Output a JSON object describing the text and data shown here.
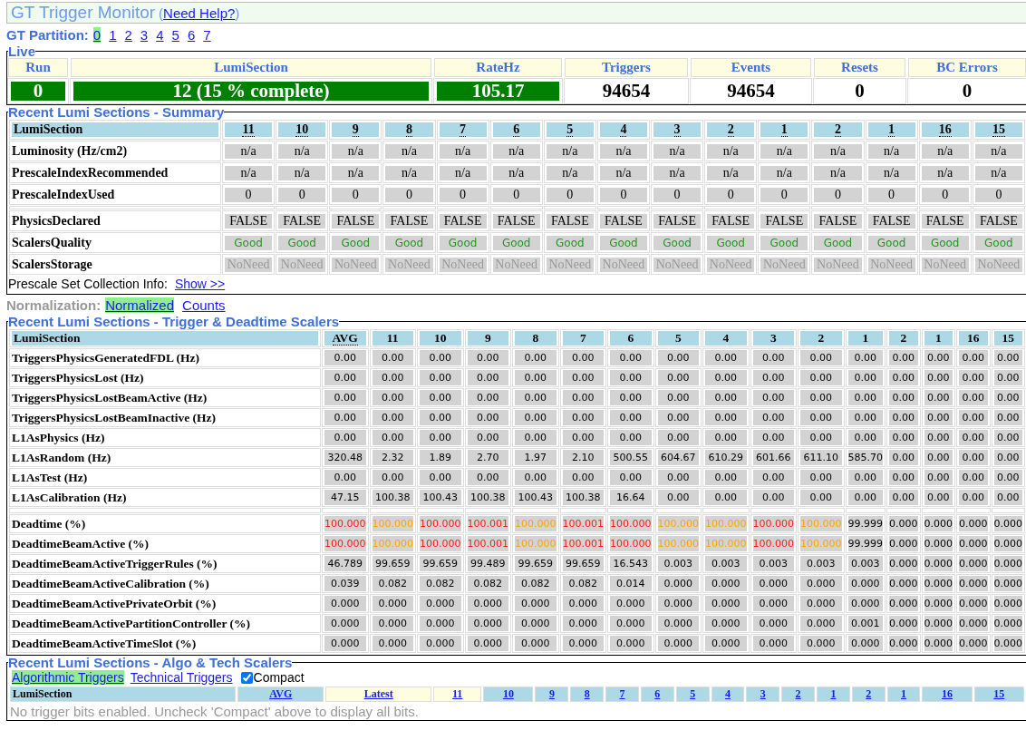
{
  "title": {
    "text": "GT Trigger Monitor",
    "paren_open": "(",
    "help_link": "Need Help?",
    "paren_close": ")"
  },
  "partition": {
    "label": "GT Partition:",
    "options": [
      {
        "label": "0",
        "selected": true
      },
      {
        "label": "1",
        "selected": false
      },
      {
        "label": "2",
        "selected": false
      },
      {
        "label": "3",
        "selected": false
      },
      {
        "label": "4",
        "selected": false
      },
      {
        "label": "5",
        "selected": false
      },
      {
        "label": "6",
        "selected": false
      },
      {
        "label": "7",
        "selected": false
      }
    ]
  },
  "live": {
    "legend": "Live",
    "items": [
      {
        "label": "Run",
        "value": "0",
        "highlighted": true
      },
      {
        "label": "LumiSection",
        "value": "12 (15 % complete)",
        "highlighted": true
      },
      {
        "label": "RateHz",
        "value": "105.17",
        "highlighted": true
      },
      {
        "label": "Triggers",
        "value": "94654",
        "highlighted": false
      },
      {
        "label": "Events",
        "value": "94654",
        "highlighted": false
      },
      {
        "label": "Resets",
        "value": "0",
        "highlighted": false
      },
      {
        "label": "BC Errors",
        "value": "0",
        "highlighted": false
      }
    ]
  },
  "summary": {
    "legend": "Recent Lumi Sections - Summary",
    "header": "LumiSection",
    "columns": [
      {
        "label": "11",
        "has_hint": true
      },
      {
        "label": "10",
        "has_hint": true
      },
      {
        "label": "9",
        "has_hint": true
      },
      {
        "label": "8",
        "has_hint": true
      },
      {
        "label": "7",
        "has_hint": true
      },
      {
        "label": "6",
        "has_hint": true
      },
      {
        "label": "5",
        "has_hint": true
      },
      {
        "label": "4",
        "has_hint": true
      },
      {
        "label": "3",
        "has_hint": true
      },
      {
        "label": "2",
        "has_hint": true
      },
      {
        "label": "1",
        "has_hint": true
      },
      {
        "label": "2",
        "has_hint": true
      },
      {
        "label": "1",
        "has_hint": true
      },
      {
        "label": "16",
        "has_hint": true
      },
      {
        "label": "15",
        "has_hint": true
      }
    ],
    "row_groups": [
      {
        "rows": [
          {
            "label": "Luminosity (Hz/cm2)",
            "kind": "plain",
            "values": [
              "n/a",
              "n/a",
              "n/a",
              "n/a",
              "n/a",
              "n/a",
              "n/a",
              "n/a",
              "n/a",
              "n/a",
              "n/a",
              "n/a",
              "n/a",
              "n/a",
              "n/a"
            ]
          },
          {
            "label": "PrescaleIndexRecommended",
            "kind": "plain",
            "values": [
              "n/a",
              "n/a",
              "n/a",
              "n/a",
              "n/a",
              "n/a",
              "n/a",
              "n/a",
              "n/a",
              "n/a",
              "n/a",
              "n/a",
              "n/a",
              "n/a",
              "n/a"
            ]
          },
          {
            "label": "PrescaleIndexUsed",
            "kind": "plain",
            "values": [
              "0",
              "0",
              "0",
              "0",
              "0",
              "0",
              "0",
              "0",
              "0",
              "0",
              "0",
              "0",
              "0",
              "0",
              "0"
            ]
          }
        ]
      },
      {
        "rows": [
          {
            "label": "PhysicsDeclared",
            "kind": "plain",
            "values": [
              "FALSE",
              "FALSE",
              "FALSE",
              "FALSE",
              "FALSE",
              "FALSE",
              "FALSE",
              "FALSE",
              "FALSE",
              "FALSE",
              "FALSE",
              "FALSE",
              "FALSE",
              "FALSE",
              "FALSE"
            ]
          },
          {
            "label": "ScalersQuality",
            "kind": "good",
            "values": [
              "Good",
              "Good",
              "Good",
              "Good",
              "Good",
              "Good",
              "Good",
              "Good",
              "Good",
              "Good",
              "Good",
              "Good",
              "Good",
              "Good",
              "Good"
            ]
          },
          {
            "label": "ScalersStorage",
            "kind": "muted",
            "values": [
              "NoNeed",
              "NoNeed",
              "NoNeed",
              "NoNeed",
              "NoNeed",
              "NoNeed",
              "NoNeed",
              "NoNeed",
              "NoNeed",
              "NoNeed",
              "NoNeed",
              "NoNeed",
              "NoNeed",
              "NoNeed",
              "NoNeed"
            ]
          }
        ]
      }
    ],
    "prescale_info": {
      "label": "Prescale Set Collection Info:",
      "link": "Show >>"
    }
  },
  "normalization": {
    "label": "Normalization:",
    "options": [
      {
        "label": "Normalized",
        "selected": true
      },
      {
        "label": "Counts",
        "selected": false
      }
    ]
  },
  "scalers": {
    "legend": "Recent Lumi Sections - Trigger & Deadtime Scalers",
    "header": "LumiSection",
    "columns": [
      {
        "label": "AVG",
        "has_hint": true
      },
      {
        "label": "11",
        "has_hint": false
      },
      {
        "label": "10",
        "has_hint": false
      },
      {
        "label": "9",
        "has_hint": false
      },
      {
        "label": "8",
        "has_hint": false
      },
      {
        "label": "7",
        "has_hint": false
      },
      {
        "label": "6",
        "has_hint": false
      },
      {
        "label": "5",
        "has_hint": false
      },
      {
        "label": "4",
        "has_hint": false
      },
      {
        "label": "3",
        "has_hint": false
      },
      {
        "label": "2",
        "has_hint": false
      },
      {
        "label": "1",
        "has_hint": false
      },
      {
        "label": "2",
        "has_hint": false
      },
      {
        "label": "1",
        "has_hint": false
      },
      {
        "label": "16",
        "has_hint": false
      },
      {
        "label": "15",
        "has_hint": false
      }
    ],
    "row_groups": [
      {
        "rows": [
          {
            "label": "TriggersPhysicsGeneratedFDL (Hz)",
            "values": [
              "0.00",
              "0.00",
              "0.00",
              "0.00",
              "0.00",
              "0.00",
              "0.00",
              "0.00",
              "0.00",
              "0.00",
              "0.00",
              "0.00",
              "0.00",
              "0.00",
              "0.00",
              "0.00"
            ]
          },
          {
            "label": "TriggersPhysicsLost (Hz)",
            "values": [
              "0.00",
              "0.00",
              "0.00",
              "0.00",
              "0.00",
              "0.00",
              "0.00",
              "0.00",
              "0.00",
              "0.00",
              "0.00",
              "0.00",
              "0.00",
              "0.00",
              "0.00",
              "0.00"
            ]
          },
          {
            "label": "TriggersPhysicsLostBeamActive (Hz)",
            "values": [
              "0.00",
              "0.00",
              "0.00",
              "0.00",
              "0.00",
              "0.00",
              "0.00",
              "0.00",
              "0.00",
              "0.00",
              "0.00",
              "0.00",
              "0.00",
              "0.00",
              "0.00",
              "0.00"
            ]
          },
          {
            "label": "TriggersPhysicsLostBeamInactive (Hz)",
            "values": [
              "0.00",
              "0.00",
              "0.00",
              "0.00",
              "0.00",
              "0.00",
              "0.00",
              "0.00",
              "0.00",
              "0.00",
              "0.00",
              "0.00",
              "0.00",
              "0.00",
              "0.00",
              "0.00"
            ]
          },
          {
            "label": "L1AsPhysics (Hz)",
            "values": [
              "0.00",
              "0.00",
              "0.00",
              "0.00",
              "0.00",
              "0.00",
              "0.00",
              "0.00",
              "0.00",
              "0.00",
              "0.00",
              "0.00",
              "0.00",
              "0.00",
              "0.00",
              "0.00"
            ]
          },
          {
            "label": "L1AsRandom (Hz)",
            "values": [
              "320.48",
              "2.32",
              "1.89",
              "2.70",
              "1.97",
              "2.10",
              "500.55",
              "604.67",
              "610.29",
              "601.66",
              "611.10",
              "585.70",
              "0.00",
              "0.00",
              "0.00",
              "0.00"
            ]
          },
          {
            "label": "L1AsTest (Hz)",
            "values": [
              "0.00",
              "0.00",
              "0.00",
              "0.00",
              "0.00",
              "0.00",
              "0.00",
              "0.00",
              "0.00",
              "0.00",
              "0.00",
              "0.00",
              "0.00",
              "0.00",
              "0.00",
              "0.00"
            ]
          },
          {
            "label": "L1AsCalibration (Hz)",
            "values": [
              "47.15",
              "100.38",
              "100.43",
              "100.38",
              "100.43",
              "100.38",
              "16.64",
              "0.00",
              "0.00",
              "0.00",
              "0.00",
              "0.00",
              "0.00",
              "0.00",
              "0.00",
              "0.00"
            ]
          }
        ]
      },
      {
        "rows": [
          {
            "label": "Deadtime (%)",
            "cells": [
              {
                "value": "100.000",
                "color": "#ff1a1a"
              },
              {
                "value": "100.000",
                "color": "#ffa500"
              },
              {
                "value": "100.000",
                "color": "#ff1a1a"
              },
              {
                "value": "100.001",
                "color": "#ff1a1a"
              },
              {
                "value": "100.000",
                "color": "#ffa500"
              },
              {
                "value": "100.001",
                "color": "#ff1a1a"
              },
              {
                "value": "100.000",
                "color": "#ff1a1a"
              },
              {
                "value": "100.000",
                "color": "#ffa500"
              },
              {
                "value": "100.000",
                "color": "#ffa500"
              },
              {
                "value": "100.000",
                "color": "#ff1a1a"
              },
              {
                "value": "100.000",
                "color": "#ffa500"
              },
              {
                "value": "99.999",
                "color": "#000000"
              },
              {
                "value": "0.000",
                "color": "#000000"
              },
              {
                "value": "0.000",
                "color": "#000000"
              },
              {
                "value": "0.000",
                "color": "#000000"
              },
              {
                "value": "0.000",
                "color": "#000000"
              }
            ]
          },
          {
            "label": "DeadtimeBeamActive (%)",
            "cells": [
              {
                "value": "100.000",
                "color": "#ff1a1a"
              },
              {
                "value": "100.000",
                "color": "#ffa500"
              },
              {
                "value": "100.000",
                "color": "#ff1a1a"
              },
              {
                "value": "100.001",
                "color": "#ff1a1a"
              },
              {
                "value": "100.000",
                "color": "#ffa500"
              },
              {
                "value": "100.001",
                "color": "#ff1a1a"
              },
              {
                "value": "100.000",
                "color": "#ff1a1a"
              },
              {
                "value": "100.000",
                "color": "#ffa500"
              },
              {
                "value": "100.000",
                "color": "#ffa500"
              },
              {
                "value": "100.000",
                "color": "#ff1a1a"
              },
              {
                "value": "100.000",
                "color": "#ffa500"
              },
              {
                "value": "99.999",
                "color": "#000000"
              },
              {
                "value": "0.000",
                "color": "#000000"
              },
              {
                "value": "0.000",
                "color": "#000000"
              },
              {
                "value": "0.000",
                "color": "#000000"
              },
              {
                "value": "0.000",
                "color": "#000000"
              }
            ]
          },
          {
            "label": "DeadtimeBeamActiveTriggerRules (%)",
            "values": [
              "46.789",
              "99.659",
              "99.659",
              "99.489",
              "99.659",
              "99.659",
              "16.543",
              "0.003",
              "0.003",
              "0.003",
              "0.003",
              "0.003",
              "0.000",
              "0.000",
              "0.000",
              "0.000"
            ]
          },
          {
            "label": "DeadtimeBeamActiveCalibration (%)",
            "values": [
              "0.039",
              "0.082",
              "0.082",
              "0.082",
              "0.082",
              "0.082",
              "0.014",
              "0.000",
              "0.000",
              "0.000",
              "0.000",
              "0.000",
              "0.000",
              "0.000",
              "0.000",
              "0.000"
            ]
          },
          {
            "label": "DeadtimeBeamActivePrivateOrbit (%)",
            "values": [
              "0.000",
              "0.000",
              "0.000",
              "0.000",
              "0.000",
              "0.000",
              "0.000",
              "0.000",
              "0.000",
              "0.000",
              "0.000",
              "0.000",
              "0.000",
              "0.000",
              "0.000",
              "0.000"
            ]
          },
          {
            "label": "DeadtimeBeamActivePartitionController (%)",
            "values": [
              "0.000",
              "0.000",
              "0.000",
              "0.000",
              "0.000",
              "0.000",
              "0.000",
              "0.000",
              "0.000",
              "0.000",
              "0.000",
              "0.001",
              "0.000",
              "0.000",
              "0.000",
              "0.000"
            ]
          },
          {
            "label": "DeadtimeBeamActiveTimeSlot (%)",
            "values": [
              "0.000",
              "0.000",
              "0.000",
              "0.000",
              "0.000",
              "0.000",
              "0.000",
              "0.000",
              "0.000",
              "0.000",
              "0.000",
              "0.000",
              "0.000",
              "0.000",
              "0.000",
              "0.000"
            ]
          }
        ]
      }
    ]
  },
  "algo": {
    "legend": "Recent Lumi Sections - Algo & Tech Scalers",
    "tabs": [
      {
        "label": "Algorithmic Triggers",
        "selected": true
      },
      {
        "label": "Technical Triggers",
        "selected": false
      }
    ],
    "compact": {
      "label": "Compact",
      "checked": true
    },
    "header": "LumiSection",
    "columns": [
      {
        "label": "AVG",
        "current": false
      },
      {
        "label": "Latest",
        "current": true
      },
      {
        "label": "11",
        "current": true
      },
      {
        "label": "10",
        "current": false
      },
      {
        "label": "9",
        "current": false
      },
      {
        "label": "8",
        "current": false
      },
      {
        "label": "7",
        "current": false
      },
      {
        "label": "6",
        "current": false
      },
      {
        "label": "5",
        "current": false
      },
      {
        "label": "4",
        "current": false
      },
      {
        "label": "3",
        "current": false
      },
      {
        "label": "2",
        "current": false
      },
      {
        "label": "1",
        "current": false
      },
      {
        "label": "2",
        "current": false
      },
      {
        "label": "1",
        "current": false
      },
      {
        "label": "16",
        "current": false
      },
      {
        "label": "15",
        "current": false
      }
    ],
    "message": "No trigger bits enabled. Uncheck 'Compact' above to display all bits."
  }
}
